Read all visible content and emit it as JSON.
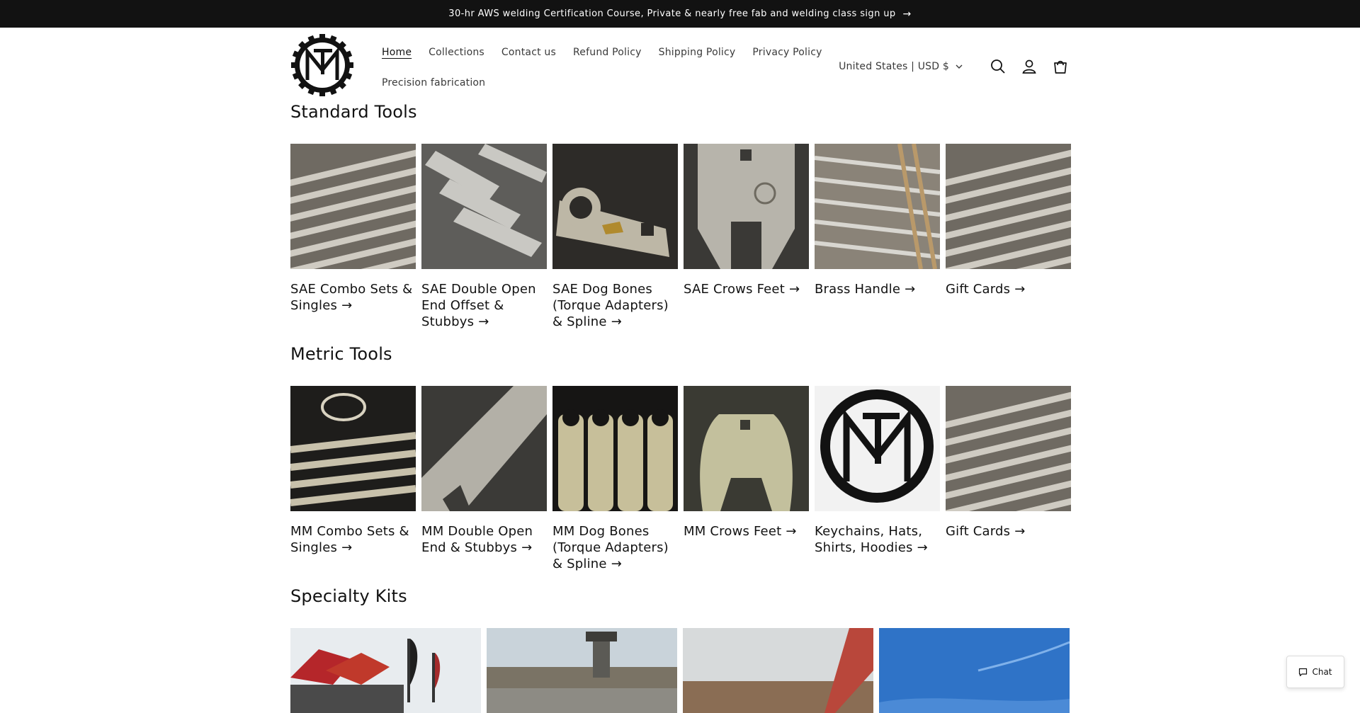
{
  "announcement": {
    "text": "30-hr AWS welding Certification Course, Private & nearly free fab and welding class sign up",
    "arrow": "→"
  },
  "header": {
    "nav": [
      {
        "label": "Home",
        "active": true
      },
      {
        "label": "Collections"
      },
      {
        "label": "Contact us"
      },
      {
        "label": "Refund Policy"
      },
      {
        "label": "Shipping Policy"
      },
      {
        "label": "Privacy Policy"
      },
      {
        "label": "Precision fabrication"
      }
    ],
    "locale": "United States | USD $",
    "icons": [
      "search-icon",
      "account-icon",
      "cart-icon",
      "chevron-down-icon"
    ]
  },
  "sections": [
    {
      "title": "Standard Tools",
      "items": [
        {
          "label": "SAE Combo Sets & Singles"
        },
        {
          "label": "SAE Double Open End Offset & Stubbys"
        },
        {
          "label": "SAE Dog Bones (Torque Adapters) & Spline"
        },
        {
          "label": "SAE Crows Feet"
        },
        {
          "label": "Brass Handle"
        },
        {
          "label": "Gift Cards"
        }
      ]
    },
    {
      "title": "Metric Tools",
      "items": [
        {
          "label": "MM Combo Sets & Singles"
        },
        {
          "label": "MM Double Open End & Stubbys"
        },
        {
          "label": "MM Dog Bones (Torque Adapters) & Spline"
        },
        {
          "label": "MM Crows Feet"
        },
        {
          "label": "Keychains, Hats, Shirts, Hoodies"
        },
        {
          "label": "Gift Cards"
        }
      ]
    },
    {
      "title": "Specialty Kits"
    }
  ],
  "chat": {
    "label": "Chat"
  },
  "colors": {
    "announce_bg": "#121212",
    "text": "#121212",
    "muted": "#3a3a3a"
  }
}
